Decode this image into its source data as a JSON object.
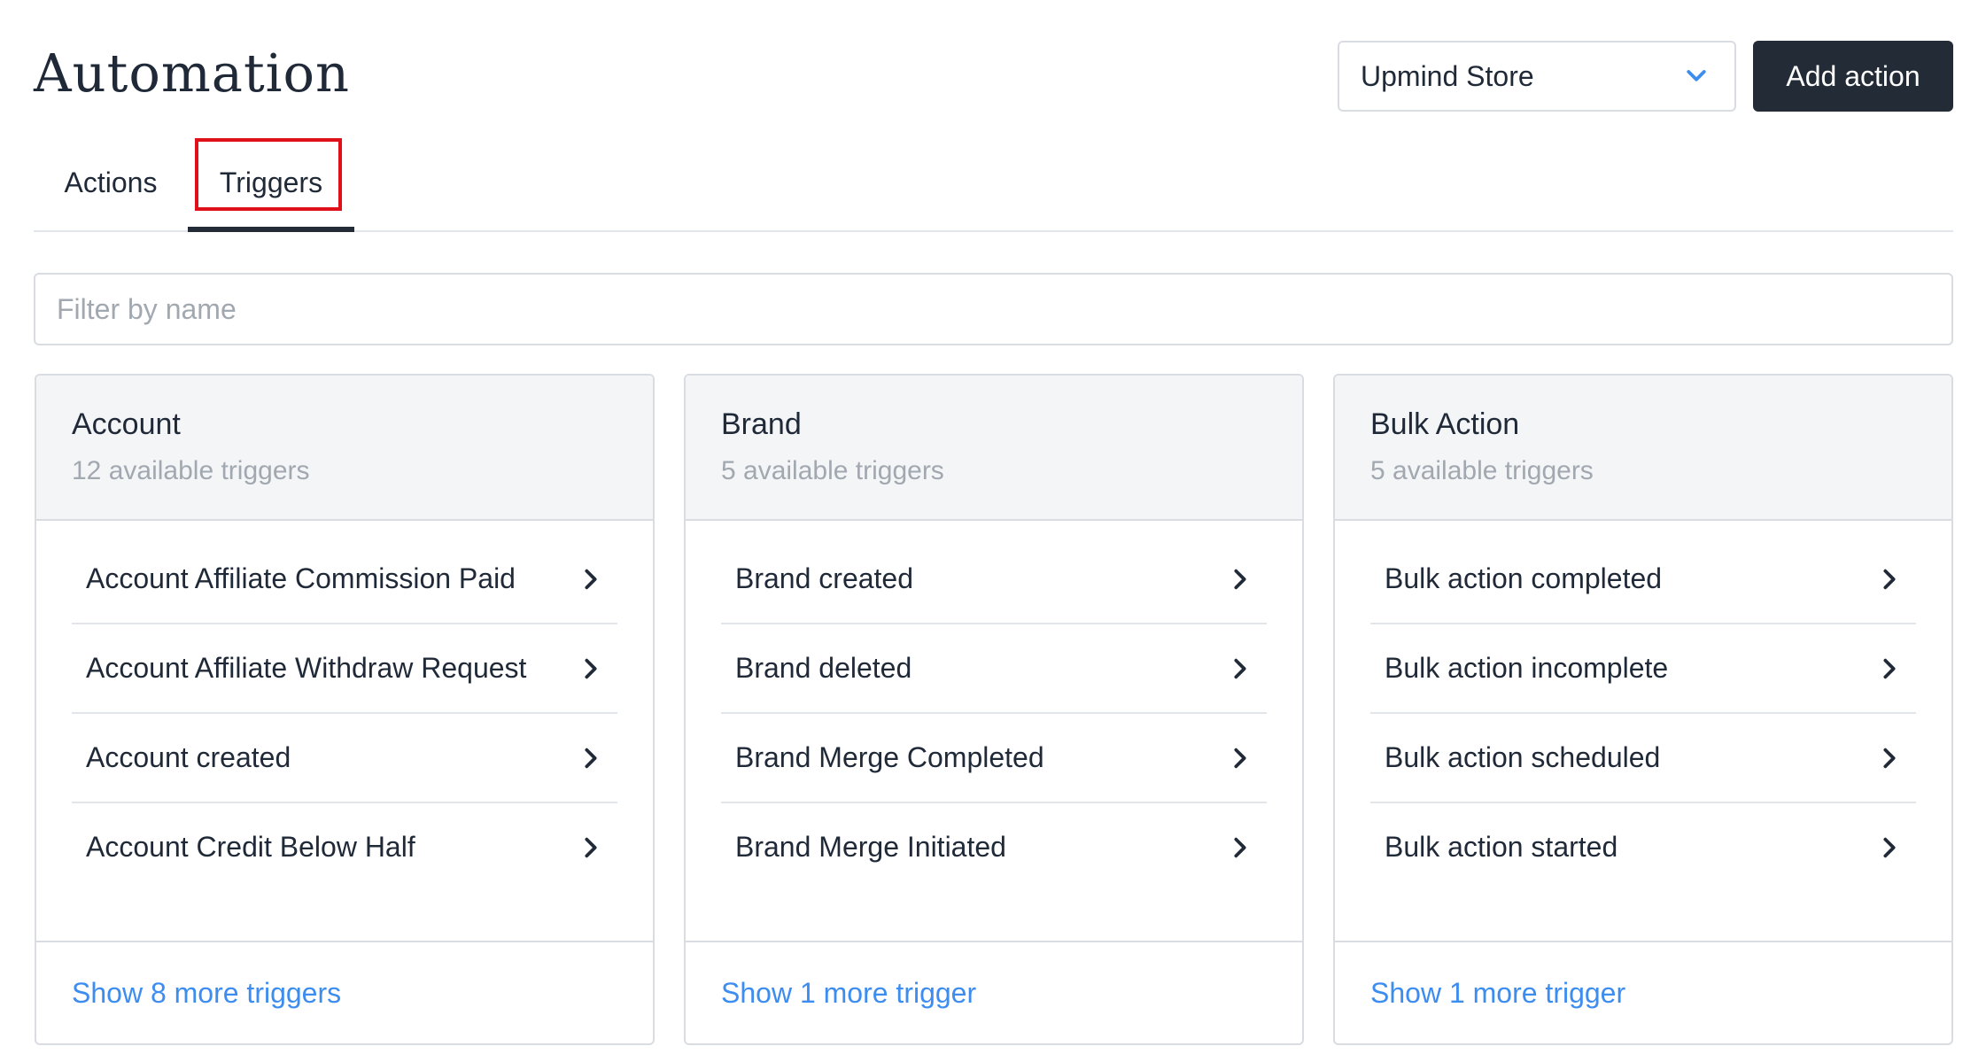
{
  "page": {
    "title": "Automation"
  },
  "header": {
    "store_select": "Upmind Store",
    "add_action_label": "Add action"
  },
  "tabs": [
    {
      "label": "Actions",
      "active": false
    },
    {
      "label": "Triggers",
      "active": true
    }
  ],
  "filter": {
    "placeholder": "Filter by name",
    "value": ""
  },
  "cards": [
    {
      "title": "Account",
      "subtitle": "12 available triggers",
      "items": [
        "Account Affiliate Commission Paid",
        "Account Affiliate Withdraw Request",
        "Account created",
        "Account Credit Below Half"
      ],
      "more": "Show 8 more triggers"
    },
    {
      "title": "Brand",
      "subtitle": "5 available triggers",
      "items": [
        "Brand created",
        "Brand deleted",
        "Brand Merge Completed",
        "Brand Merge Initiated"
      ],
      "more": "Show 1 more trigger"
    },
    {
      "title": "Bulk Action",
      "subtitle": "5 available triggers",
      "items": [
        "Bulk action completed",
        "Bulk action incomplete",
        "Bulk action scheduled",
        "Bulk action started"
      ],
      "more": "Show 1 more trigger"
    }
  ],
  "colors": {
    "primary_dark": "#232b36",
    "link": "#3d8df0",
    "chevron": "#3d8df0",
    "highlight": "#e0101a",
    "card_header_bg": "#f4f5f7",
    "muted_text": "#a2a8b0"
  }
}
